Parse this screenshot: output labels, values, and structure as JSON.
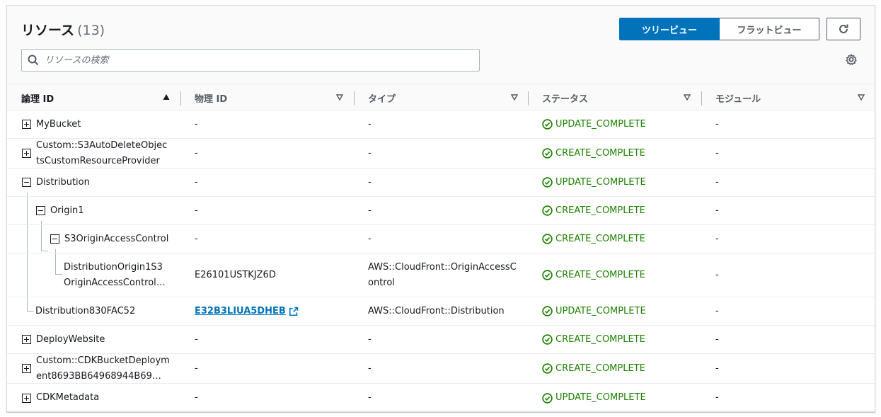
{
  "header": {
    "title": "リソース",
    "count": "(13)",
    "tree_view_label": "ツリービュー",
    "flat_view_label": "フラットビュー"
  },
  "search": {
    "placeholder": "リソースの検索"
  },
  "columns": {
    "logical_id": "論理 ID",
    "physical_id": "物理 ID",
    "type": "タイプ",
    "status": "ステータス",
    "module": "モジュール"
  },
  "rows": [
    {
      "logical_line1": "MyBucket",
      "logical_line2": "",
      "physical": "-",
      "type_line1": "-",
      "type_line2": "",
      "status": "UPDATE_COMPLETE",
      "module": "-"
    },
    {
      "logical_line1": "Custom::S3AutoDeleteObjec",
      "logical_line2": "tsCustomResourceProvider",
      "physical": "-",
      "type_line1": "-",
      "type_line2": "",
      "status": "CREATE_COMPLETE",
      "module": "-"
    },
    {
      "logical_line1": "Distribution",
      "logical_line2": "",
      "physical": "-",
      "type_line1": "-",
      "type_line2": "",
      "status": "UPDATE_COMPLETE",
      "module": "-"
    },
    {
      "logical_line1": "Origin1",
      "logical_line2": "",
      "physical": "-",
      "type_line1": "-",
      "type_line2": "",
      "status": "CREATE_COMPLETE",
      "module": "-"
    },
    {
      "logical_line1": "S3OriginAccessControl",
      "logical_line2": "",
      "physical": "-",
      "type_line1": "-",
      "type_line2": "",
      "status": "CREATE_COMPLETE",
      "module": "-"
    },
    {
      "logical_line1": "DistributionOrigin1S3",
      "logical_line2": "OriginAccessControl…",
      "physical": "E26101USTKJZ6D",
      "type_line1": "AWS::CloudFront::OriginAccessC",
      "type_line2": "ontrol",
      "status": "CREATE_COMPLETE",
      "module": "-"
    },
    {
      "logical_line1": "Distribution830FAC52",
      "logical_line2": "",
      "physical": "E32B3LIUA5DHEB",
      "type_line1": "AWS::CloudFront::Distribution",
      "type_line2": "",
      "status": "UPDATE_COMPLETE",
      "module": "-"
    },
    {
      "logical_line1": "DeployWebsite",
      "logical_line2": "",
      "physical": "-",
      "type_line1": "-",
      "type_line2": "",
      "status": "CREATE_COMPLETE",
      "module": "-"
    },
    {
      "logical_line1": "Custom::CDKBucketDeploym",
      "logical_line2": "ent8693BB64968944B69…",
      "physical": "-",
      "type_line1": "-",
      "type_line2": "",
      "status": "CREATE_COMPLETE",
      "module": "-"
    },
    {
      "logical_line1": "CDKMetadata",
      "logical_line2": "",
      "physical": "-",
      "type_line1": "-",
      "type_line2": "",
      "status": "UPDATE_COMPLETE",
      "module": "-"
    }
  ],
  "colors": {
    "accent": "#0073bb",
    "success": "#1d8102"
  }
}
